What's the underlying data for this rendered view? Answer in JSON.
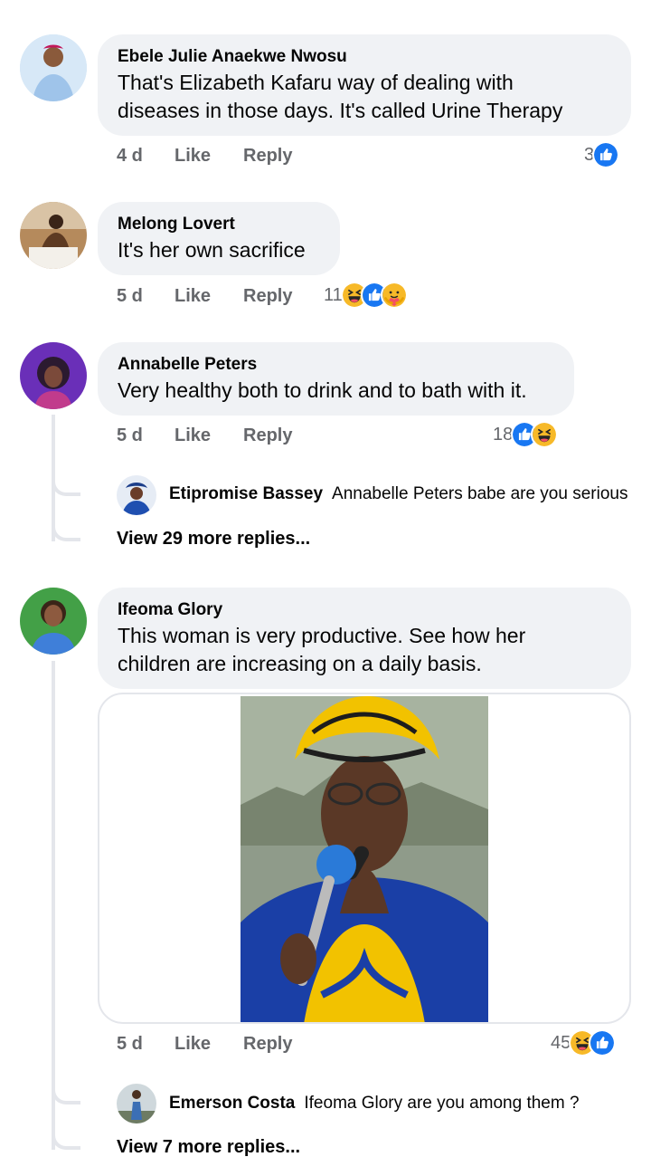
{
  "comments": [
    {
      "author": "Ebele Julie Anaekwe Nwosu",
      "text_line1": "That's Elizabeth Kafaru way of dealing with",
      "text_line2": "diseases in those days. It's called Urine Therapy",
      "time": "4 d",
      "like_label": "Like",
      "reply_label": "Reply",
      "reaction_count": "3",
      "reactions": [
        "like-icon"
      ]
    },
    {
      "author": "Melong Lovert",
      "text_line1": "It's her own sacrifice",
      "time": "5 d",
      "like_label": "Like",
      "reply_label": "Reply",
      "reaction_count": "11",
      "reactions": [
        "haha-icon",
        "like-icon",
        "care-icon"
      ]
    },
    {
      "author": "Annabelle Peters",
      "text_line1": "Very healthy both to drink and to bath with it.",
      "time": "5 d",
      "like_label": "Like",
      "reply_label": "Reply",
      "reaction_count": "18",
      "reactions": [
        "like-icon",
        "haha-icon"
      ],
      "reply": {
        "author": "Etipromise Bassey",
        "text": "Annabelle Peters babe are you serious"
      },
      "view_more": "View 29 more replies..."
    },
    {
      "author": "Ifeoma Glory",
      "text_line1": "This woman is very productive. See how her",
      "text_line2": "children are increasing on a daily basis.",
      "time": "5 d",
      "like_label": "Like",
      "reply_label": "Reply",
      "reaction_count": "45",
      "reactions": [
        "haha-icon",
        "like-icon"
      ],
      "reply": {
        "author": "Emerson Costa",
        "text": "Ifeoma Glory are you among them ?"
      },
      "view_more": "View 7 more replies..."
    }
  ],
  "colors": {
    "bubble_bg": "#f0f2f5",
    "meta_text": "#65676b",
    "like_blue": "#1877f2",
    "haha_yellow": "#f7b928",
    "thread_line": "#e4e6eb"
  }
}
